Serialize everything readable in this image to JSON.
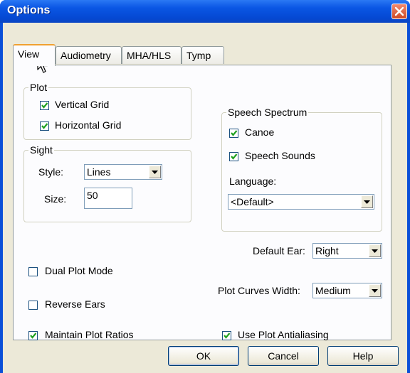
{
  "window": {
    "title": "Options"
  },
  "tabs": [
    "View",
    "Audiometry",
    "MHA/HLS",
    "Tymp"
  ],
  "plot": {
    "group_label": "Plot",
    "vertical_grid": {
      "label": "Vertical Grid",
      "checked": true
    },
    "horizontal_grid": {
      "label": "Horizontal Grid",
      "checked": true
    }
  },
  "sight": {
    "group_label": "Sight",
    "style_label": "Style:",
    "style_value": "Lines",
    "size_label": "Size:",
    "size_value": "50"
  },
  "speech_spectrum": {
    "group_label": "Speech Spectrum",
    "canoe": {
      "label": "Canoe",
      "checked": true
    },
    "speech_sounds": {
      "label": "Speech Sounds",
      "checked": true
    },
    "language_label": "Language:",
    "language_value": "<Default>"
  },
  "default_ear": {
    "label": "Default Ear:",
    "value": "Right"
  },
  "plot_curves_width": {
    "label": "Plot Curves Width:",
    "value": "Medium"
  },
  "dual_plot_mode": {
    "label": "Dual Plot Mode",
    "checked": false
  },
  "reverse_ears": {
    "label": "Reverse Ears",
    "checked": false
  },
  "maintain_plot_ratios": {
    "label": "Maintain Plot Ratios",
    "checked": true
  },
  "use_plot_antialiasing": {
    "label": "Use Plot Antialiasing",
    "checked": true
  },
  "buttons": {
    "ok": "OK",
    "cancel": "Cancel",
    "help": "Help"
  }
}
